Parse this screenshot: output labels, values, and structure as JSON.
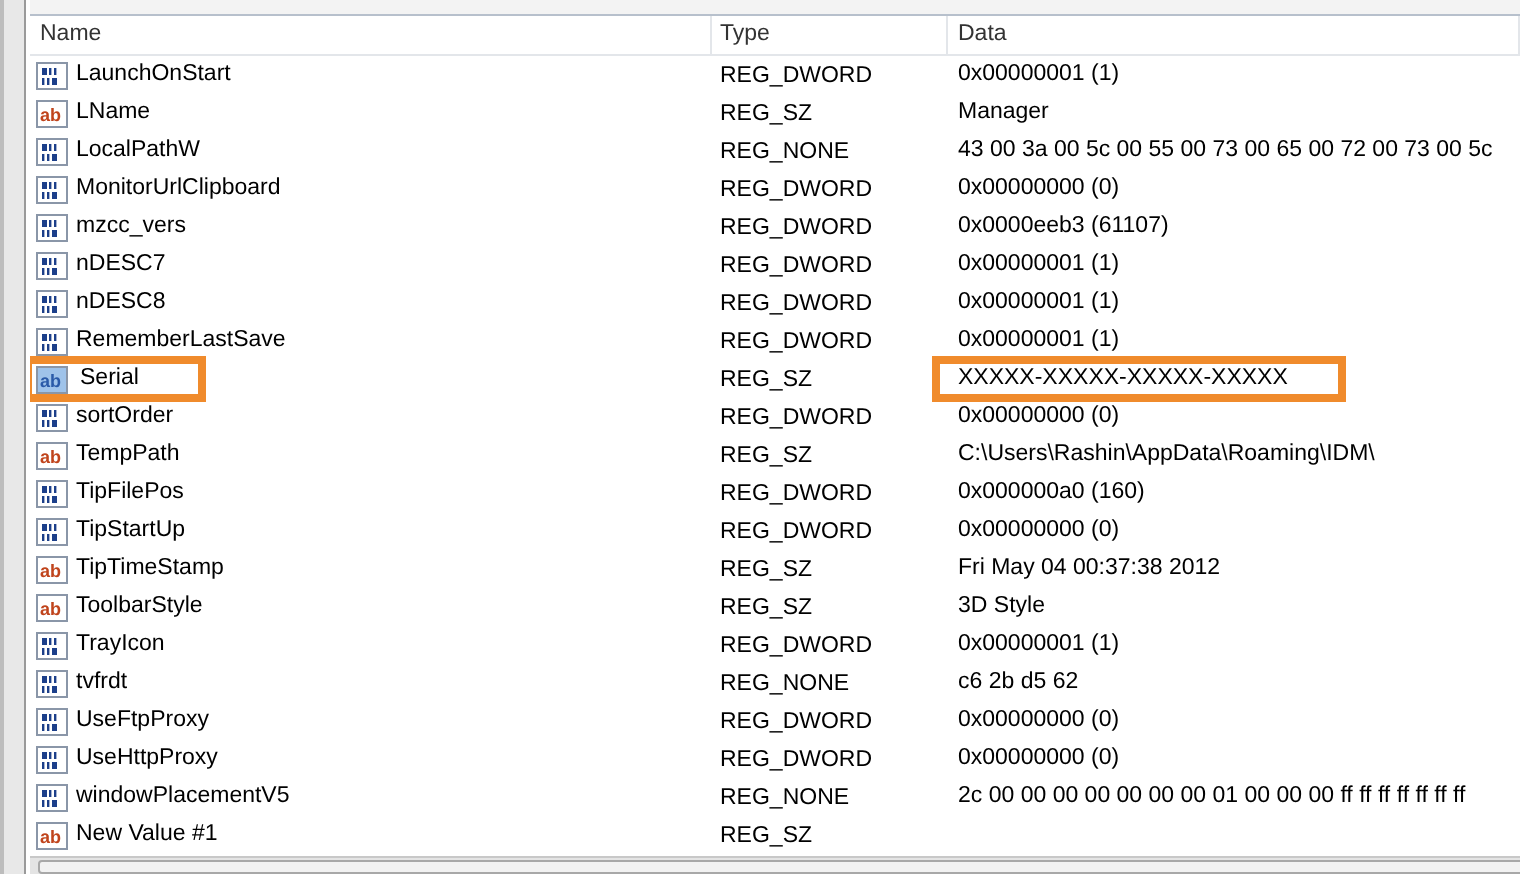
{
  "table": {
    "columns": [
      "Name",
      "Type",
      "Data"
    ],
    "rows": [
      {
        "kind": "binary",
        "name": "LaunchOnStart",
        "type": "REG_DWORD",
        "data": "0x00000001 (1)",
        "selected": false,
        "highlighted": false
      },
      {
        "kind": "string",
        "icon_label": "ab",
        "name": "LName",
        "type": "REG_SZ",
        "data": "Manager",
        "selected": false,
        "highlighted": false
      },
      {
        "kind": "binary",
        "name": "LocalPathW",
        "type": "REG_NONE",
        "data": "43 00 3a 00 5c 00 55 00 73 00 65 00 72 00 73 00 5c",
        "selected": false,
        "highlighted": false
      },
      {
        "kind": "binary",
        "name": "MonitorUrlClipboard",
        "type": "REG_DWORD",
        "data": "0x00000000 (0)",
        "selected": false,
        "highlighted": false
      },
      {
        "kind": "binary",
        "name": "mzcc_vers",
        "type": "REG_DWORD",
        "data": "0x0000eeb3 (61107)",
        "selected": false,
        "highlighted": false
      },
      {
        "kind": "binary",
        "name": "nDESC7",
        "type": "REG_DWORD",
        "data": "0x00000001 (1)",
        "selected": false,
        "highlighted": false
      },
      {
        "kind": "binary",
        "name": "nDESC8",
        "type": "REG_DWORD",
        "data": "0x00000001 (1)",
        "selected": false,
        "highlighted": false
      },
      {
        "kind": "binary",
        "name": "RememberLastSave",
        "type": "REG_DWORD",
        "data": "0x00000001 (1)",
        "selected": false,
        "highlighted": false
      },
      {
        "kind": "string",
        "icon_label": "ab",
        "name": "Serial",
        "type": "REG_SZ",
        "data": "XXXXX-XXXXX-XXXXX-XXXXX",
        "selected": true,
        "highlighted": true
      },
      {
        "kind": "binary",
        "name": "sortOrder",
        "type": "REG_DWORD",
        "data": "0x00000000 (0)",
        "selected": false,
        "highlighted": false
      },
      {
        "kind": "string",
        "icon_label": "ab",
        "name": "TempPath",
        "type": "REG_SZ",
        "data": "C:\\Users\\Rashin\\AppData\\Roaming\\IDM\\",
        "selected": false,
        "highlighted": false
      },
      {
        "kind": "binary",
        "name": "TipFilePos",
        "type": "REG_DWORD",
        "data": "0x000000a0 (160)",
        "selected": false,
        "highlighted": false
      },
      {
        "kind": "binary",
        "name": "TipStartUp",
        "type": "REG_DWORD",
        "data": "0x00000000 (0)",
        "selected": false,
        "highlighted": false
      },
      {
        "kind": "string",
        "icon_label": "ab",
        "name": "TipTimeStamp",
        "type": "REG_SZ",
        "data": "Fri May 04 00:37:38 2012",
        "selected": false,
        "highlighted": false
      },
      {
        "kind": "string",
        "icon_label": "ab",
        "name": "ToolbarStyle",
        "type": "REG_SZ",
        "data": "3D Style",
        "selected": false,
        "highlighted": false
      },
      {
        "kind": "binary",
        "name": "TrayIcon",
        "type": "REG_DWORD",
        "data": "0x00000001 (1)",
        "selected": false,
        "highlighted": false
      },
      {
        "kind": "binary",
        "name": "tvfrdt",
        "type": "REG_NONE",
        "data": "c6 2b d5 62",
        "selected": false,
        "highlighted": false
      },
      {
        "kind": "binary",
        "name": "UseFtpProxy",
        "type": "REG_DWORD",
        "data": "0x00000000 (0)",
        "selected": false,
        "highlighted": false
      },
      {
        "kind": "binary",
        "name": "UseHttpProxy",
        "type": "REG_DWORD",
        "data": "0x00000000 (0)",
        "selected": false,
        "highlighted": false
      },
      {
        "kind": "binary",
        "name": "windowPlacementV5",
        "type": "REG_NONE",
        "data": "2c 00 00 00 00 00 00 00 01 00 00 00 ff ff ff ff ff ff ff",
        "selected": false,
        "highlighted": false
      },
      {
        "kind": "string",
        "icon_label": "ab",
        "name": "New Value #1",
        "type": "REG_SZ",
        "selected": false,
        "highlighted": false
      }
    ]
  }
}
